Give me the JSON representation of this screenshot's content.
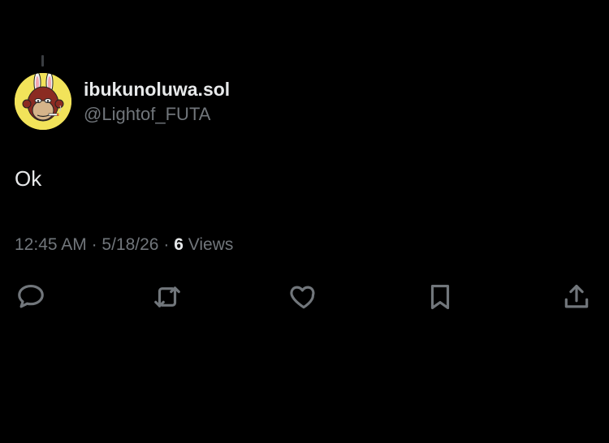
{
  "author": {
    "display_name": "ibukunoluwa.sol",
    "handle": "@Lightof_FUTA",
    "avatar": "ape-avatar"
  },
  "tweet": {
    "text": "Ok"
  },
  "meta": {
    "time": "12:45 AM",
    "separator": "·",
    "date": "5/18/26",
    "views_count": "6",
    "views_label": "Views"
  },
  "actions": [
    {
      "name": "reply",
      "icon": "reply-icon"
    },
    {
      "name": "retweet",
      "icon": "retweet-icon"
    },
    {
      "name": "like",
      "icon": "heart-icon"
    },
    {
      "name": "bookmark",
      "icon": "bookmark-icon"
    },
    {
      "name": "share",
      "icon": "share-icon"
    }
  ],
  "colors": {
    "background": "#000000",
    "primary_text": "#e7e9ea",
    "secondary_text": "#71767b"
  }
}
